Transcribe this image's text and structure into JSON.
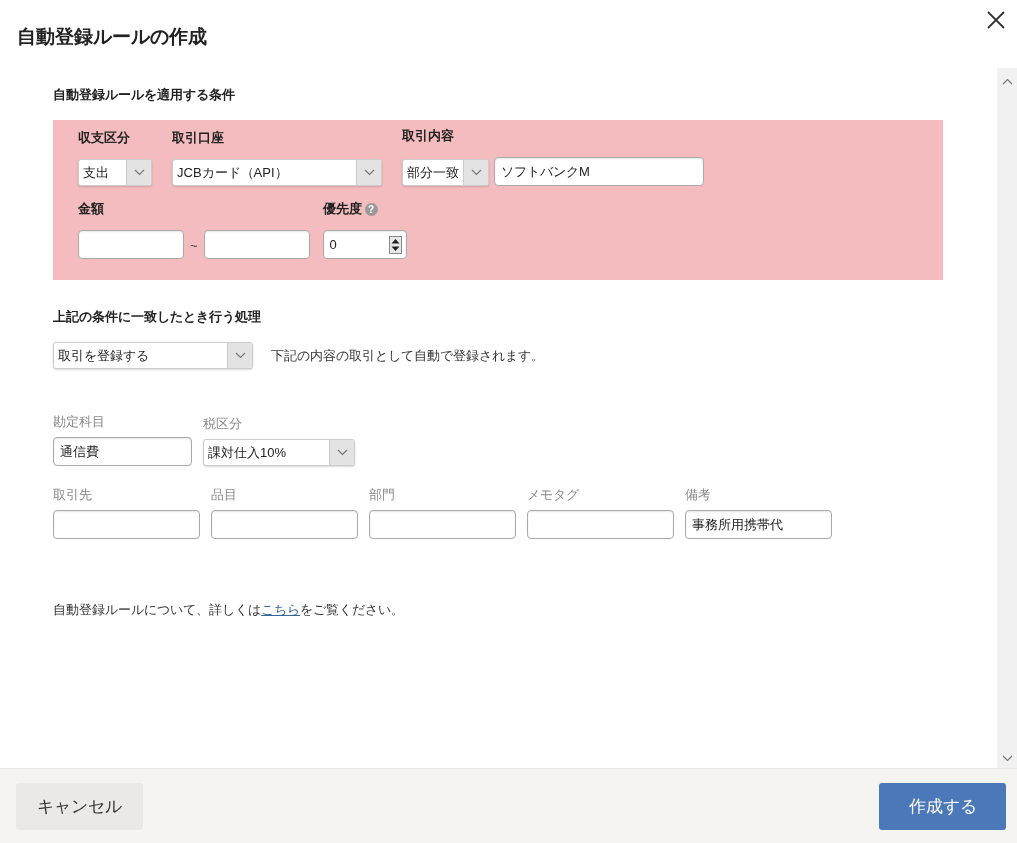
{
  "dialog": {
    "title": "自動登録ルールの作成"
  },
  "conditions": {
    "heading": "自動登録ルールを適用する条件",
    "type": {
      "label": "収支区分",
      "value": "支出"
    },
    "account": {
      "label": "取引口座",
      "value": "JCBカード（API）"
    },
    "content": {
      "label": "取引内容",
      "match": "部分一致",
      "value": "ソフトバンクM"
    },
    "amount": {
      "label": "金額",
      "separator": "~"
    },
    "priority": {
      "label": "優先度",
      "help": "?",
      "value": "0"
    }
  },
  "action": {
    "heading": "上記の条件に一致したとき行う処理",
    "value": "取引を登録する",
    "description": "下記の内容の取引として自動で登録されます。"
  },
  "entry": {
    "account_item": {
      "label": "勘定科目",
      "value": "通信費"
    },
    "tax": {
      "label": "税区分",
      "value": "課対仕入10%"
    },
    "fields": [
      {
        "label": "取引先"
      },
      {
        "label": "品目"
      },
      {
        "label": "部門"
      },
      {
        "label": "メモタグ"
      },
      {
        "label": "備考",
        "value": "事務所用携帯代"
      }
    ]
  },
  "note": {
    "before": "自動登録ルールについて、詳しくは",
    "link": "こちら",
    "after": "をご覧ください。"
  },
  "buttons": {
    "cancel": "キャンセル",
    "create": "作成する"
  }
}
